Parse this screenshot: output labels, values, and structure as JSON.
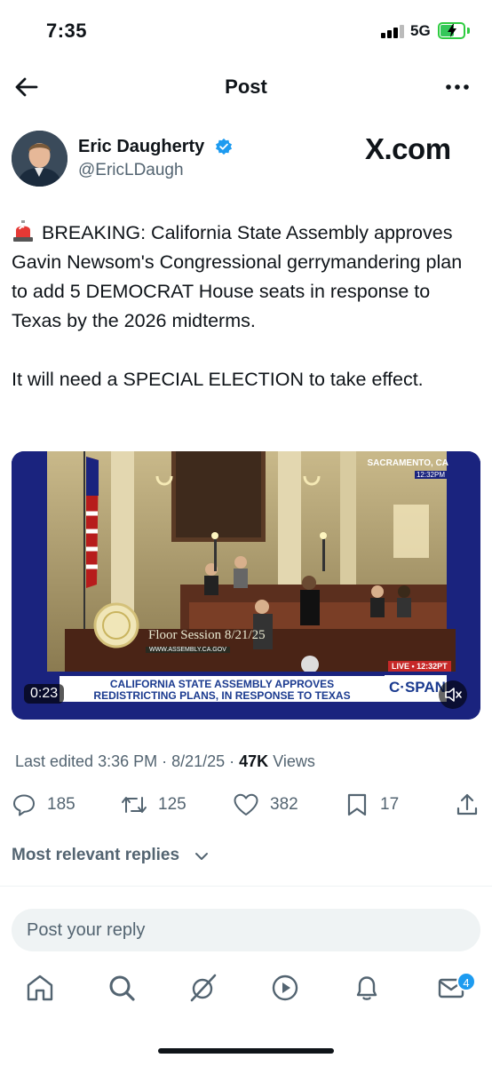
{
  "status_bar": {
    "time": "7:35",
    "network": "5G",
    "battery_level": 0.6
  },
  "header": {
    "title": "Post"
  },
  "author": {
    "name": "Eric Daugherty",
    "handle": "@EricLDaugh",
    "watermark": "X.com"
  },
  "post": {
    "paragraph_1": "BREAKING: California State Assembly approves Gavin Newsom's Congressional gerrymandering plan to add 5 DEMOCRAT House seats in response to Texas by the 2026 midterms.",
    "paragraph_2": "It will need a SPECIAL ELECTION to take effect.",
    "emoji_icon": "siren-icon"
  },
  "video": {
    "location": "SACRAMENTO, CA",
    "clock": "12:32PM",
    "floor_caption": "Floor Session 8/21/25",
    "floor_url": "WWW.ASSEMBLY.CA.GOV",
    "live_label": "LIVE • 12:32PT",
    "chyron_line_1": "CALIFORNIA STATE ASSEMBLY APPROVES",
    "chyron_line_2": "REDISTRICTING PLANS, IN RESPONSE TO TEXAS",
    "network_logo": "C·SPAN",
    "duration": "0:23"
  },
  "meta": {
    "edited": "Last edited 3:36 PM · 8/21/25 · ",
    "views_count": "47K",
    "views_label": " Views"
  },
  "actions": {
    "replies": "185",
    "reposts": "125",
    "likes": "382",
    "bookmarks": "17"
  },
  "replies_sort": "Most relevant replies",
  "reply_placeholder": "Post your reply",
  "bottom_nav": {
    "messages_badge": "4"
  },
  "colors": {
    "accent": "#1d9bf0",
    "secondary_text": "#536471",
    "primary_text": "#0f1419"
  }
}
